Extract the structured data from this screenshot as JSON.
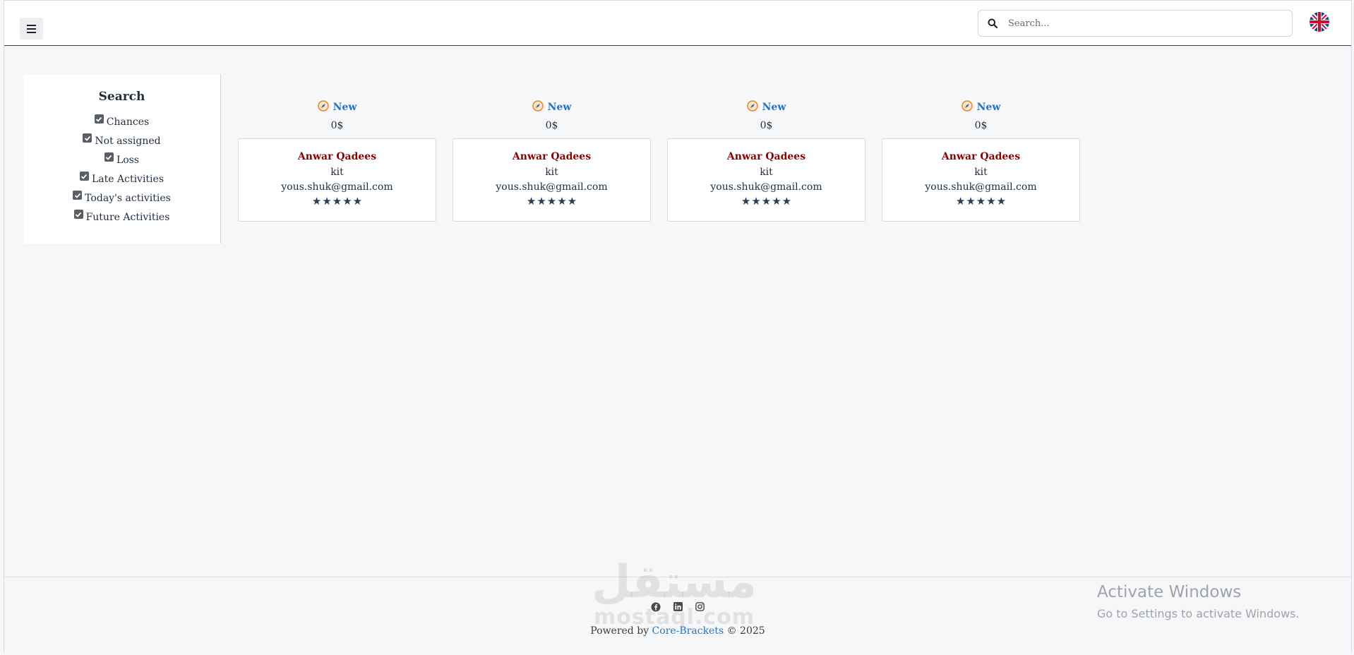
{
  "header": {
    "search_placeholder": "Search...",
    "language_flag": "uk-flag-icon"
  },
  "sidebar": {
    "title": "Search",
    "filters": [
      {
        "label": "Chances",
        "checked": true
      },
      {
        "label": "Not assigned",
        "checked": true
      },
      {
        "label": "Loss",
        "checked": true
      },
      {
        "label": "Late Activities",
        "checked": true
      },
      {
        "label": "Today's activities",
        "checked": true
      },
      {
        "label": "Future Activities",
        "checked": true
      }
    ]
  },
  "columns": [
    {
      "status": "New",
      "amount": "0$",
      "card": {
        "name": "Anwar Qadees",
        "company": "kit",
        "email": "yous.shuk@gmail.com",
        "rating": 5
      }
    },
    {
      "status": "New",
      "amount": "0$",
      "card": {
        "name": "Anwar Qadees",
        "company": "kit",
        "email": "yous.shuk@gmail.com",
        "rating": 5
      }
    },
    {
      "status": "New",
      "amount": "0$",
      "card": {
        "name": "Anwar Qadees",
        "company": "kit",
        "email": "yous.shuk@gmail.com",
        "rating": 5
      }
    },
    {
      "status": "New",
      "amount": "0$",
      "card": {
        "name": "Anwar Qadees",
        "company": "kit",
        "email": "yous.shuk@gmail.com",
        "rating": 5
      }
    }
  ],
  "footer": {
    "social_icons": [
      "facebook-icon",
      "linkedin-icon",
      "instagram-icon"
    ],
    "powered_prefix": "Powered by",
    "brand_link": "Core-Brackets",
    "copyright": "© 2025"
  },
  "watermark": {
    "arabic": "مستقل",
    "latin": "mostaql.com"
  },
  "os_overlay": {
    "title": "Activate Windows",
    "subtitle": "Go to Settings to activate Windows."
  },
  "colors": {
    "accent": "#1f74c7",
    "name": "#8b0000",
    "text": "#2c3e50"
  }
}
